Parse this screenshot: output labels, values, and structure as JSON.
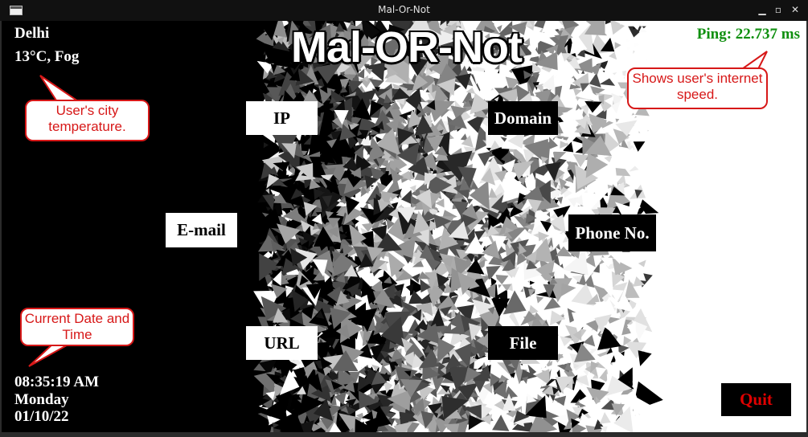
{
  "window": {
    "title": "Mal-Or-Not"
  },
  "app": {
    "title": "Mal-OR-Not",
    "weather": {
      "city": "Delhi",
      "conditions": "13°C, Fog"
    },
    "ping": "Ping: 22.737 ms",
    "datetime": {
      "time": "08:35:19 AM",
      "day": "Monday",
      "date": "01/10/22"
    },
    "buttons": {
      "ip": "IP",
      "domain": "Domain",
      "email": "E-mail",
      "phone": "Phone No.",
      "url": "URL",
      "file": "File",
      "quit": "Quit"
    }
  },
  "callouts": {
    "weather": "User's city temperature.",
    "ping": "Shows user's internet speed.",
    "datetime": "Current Date and Time"
  },
  "colors": {
    "ping": "#109010",
    "quit": "#e00000",
    "callout_border": "#d71818"
  }
}
